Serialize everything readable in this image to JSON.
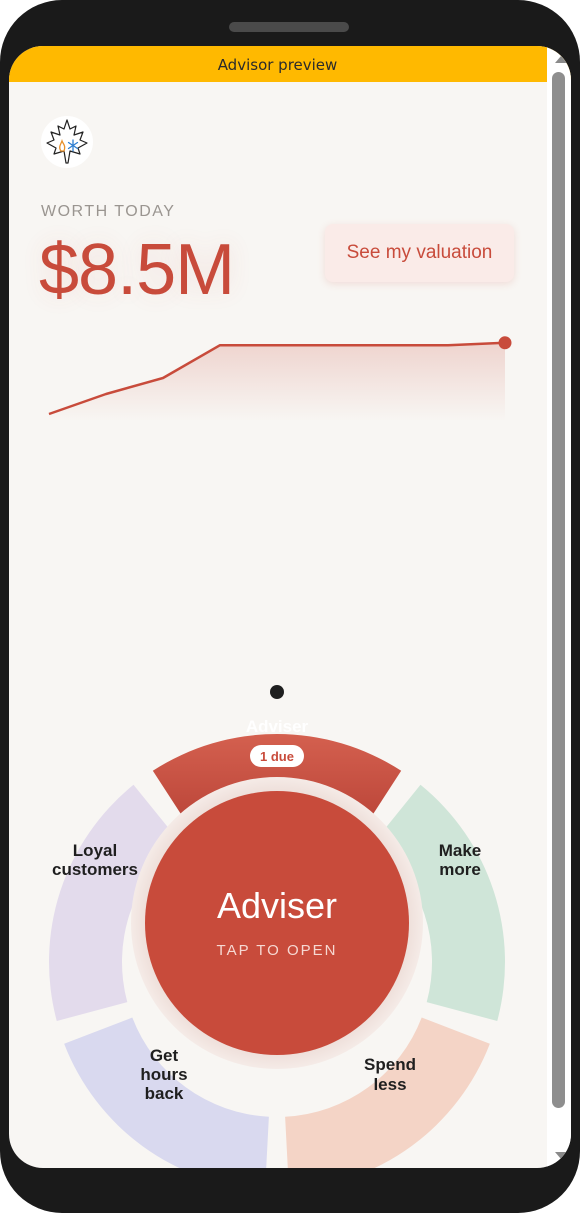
{
  "device_bar": {
    "title": "Advisor preview"
  },
  "header": {
    "logo_icon": "maple-leaf-fire-snowflake-logo"
  },
  "worth": {
    "label": "WORTH TODAY",
    "value": "$8.5M",
    "button_label": "See my valuation"
  },
  "trend": {
    "color": "#c84b3b",
    "values": [
      0,
      0.25,
      0.45,
      0.86,
      0.86,
      0.86,
      0.86,
      0.86,
      0.89
    ]
  },
  "wheel": {
    "segments": [
      {
        "id": "adviser",
        "label": "Adviser",
        "badge": "1 due",
        "color": "#c84b3b"
      },
      {
        "id": "make-more",
        "label_lines": [
          "Make",
          "more"
        ],
        "color": "#cfe5d8"
      },
      {
        "id": "spend-less",
        "label_lines": [
          "Spend",
          "less"
        ],
        "color": "#f4d4c6"
      },
      {
        "id": "get-hours-back",
        "label_lines": [
          "Get",
          "hours",
          "back"
        ],
        "color": "#d9d9ef"
      },
      {
        "id": "loyal-customers",
        "label_lines": [
          "Loyal",
          "customers"
        ],
        "color": "#e3dbec"
      }
    ],
    "center": {
      "title": "Adviser",
      "subtitle": "TAP TO OPEN",
      "color": "#c84b3b"
    }
  },
  "colors": {
    "accent": "#c84b3b",
    "banner": "#ffb900",
    "background": "#f8f6f3"
  }
}
